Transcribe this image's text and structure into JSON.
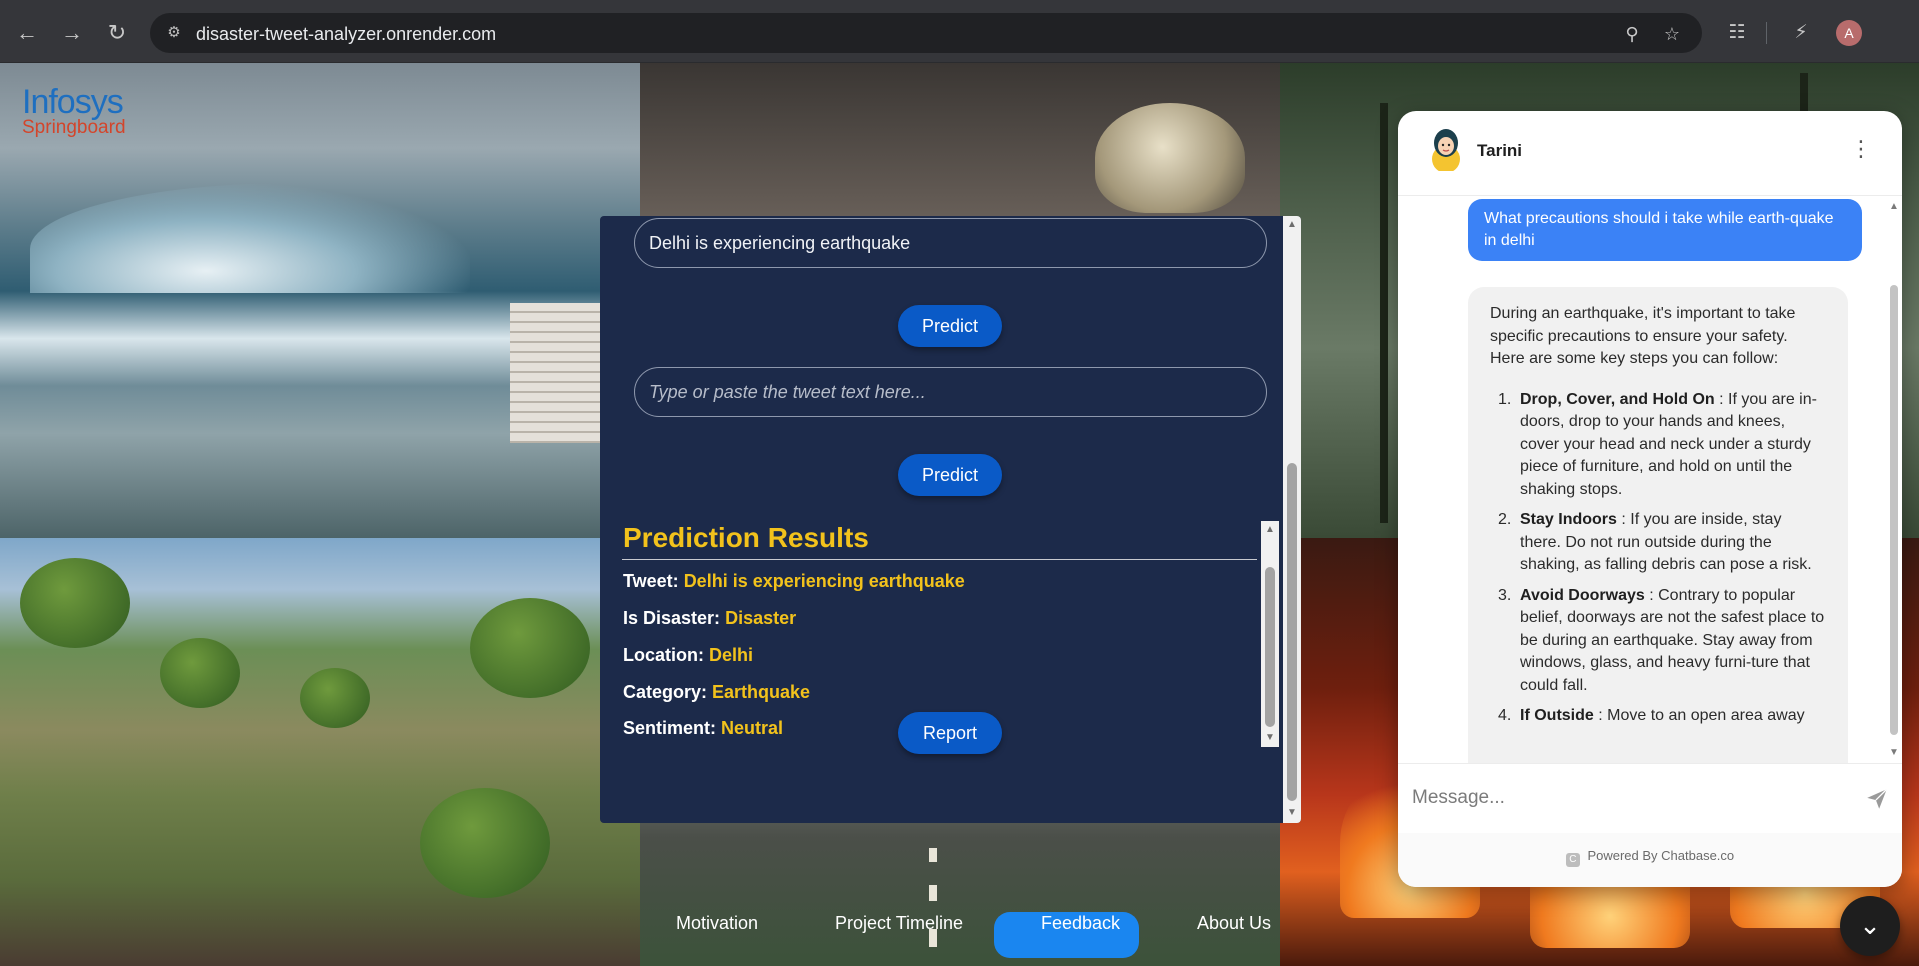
{
  "browser": {
    "url": "disaster-tweet-analyzer.onrender.com",
    "profile_initial": "A"
  },
  "logo": {
    "line1": "Infosys",
    "line2": "Springboard"
  },
  "form": {
    "tweet_value": "Delhi is experiencing earthquake",
    "tweet_placeholder": "Type or paste the tweet text here...",
    "predict_label": "Predict",
    "report_label": "Report"
  },
  "results": {
    "title": "Prediction Results",
    "rows": [
      {
        "label": "Tweet:",
        "value": "Delhi is experiencing earthquake"
      },
      {
        "label": "Is Disaster:",
        "value": "Disaster"
      },
      {
        "label": "Location:",
        "value": "Delhi"
      },
      {
        "label": "Category:",
        "value": "Earthquake"
      },
      {
        "label": "Sentiment:",
        "value": "Neutral"
      }
    ]
  },
  "nav": {
    "items": [
      "Motivation",
      "Project Timeline",
      "Feedback",
      "About Us"
    ],
    "active": "Feedback"
  },
  "chat": {
    "bot_name": "Tarini",
    "user_message": "What precautions should i take while earth-quake in delhi",
    "bot_intro": "During an earthquake, it's important to take specific precautions to ensure your safety. Here are some key steps you can follow:",
    "steps": [
      {
        "num": "1.",
        "title": "Drop, Cover, and Hold On",
        "text": ": If you are in-doors, drop to your hands and knees, cover your head and neck under a sturdy piece of furniture, and hold on until the shaking stops."
      },
      {
        "num": "2.",
        "title": "Stay Indoors",
        "text": ": If you are inside, stay there. Do not run outside during the shaking, as falling debris can pose a risk."
      },
      {
        "num": "3.",
        "title": "Avoid Doorways",
        "text": ": Contrary to popular belief, doorways are not the safest place to be during an earthquake. Stay away from windows, glass, and heavy furni-ture that could fall."
      },
      {
        "num": "4.",
        "title": "If Outside",
        "text": ": Move to an open area away"
      }
    ],
    "input_placeholder": "Message...",
    "powered_by": "Powered By Chatbase.co"
  },
  "colors": {
    "panel_bg": "#1c2a4a",
    "accent_yellow": "#f2c21c",
    "button_blue": "#0a5ac7",
    "user_bubble": "#3b82f6"
  }
}
